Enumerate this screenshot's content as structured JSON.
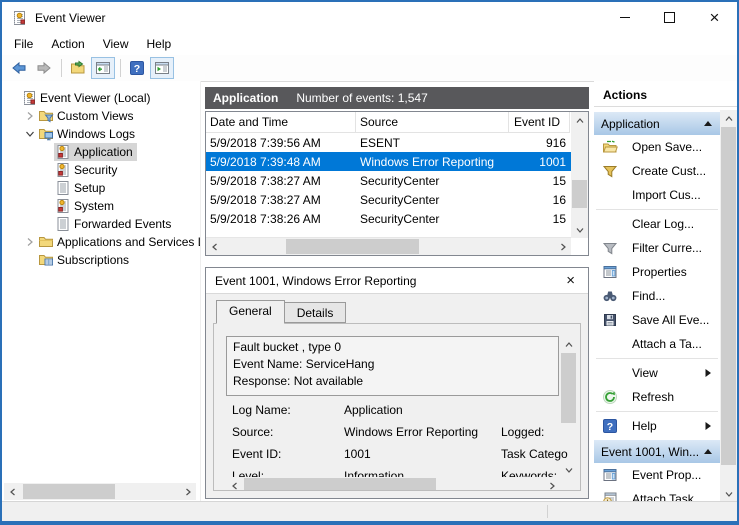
{
  "colors": {
    "window_border": "#2a70b8",
    "selection_blue": "#0078d7",
    "inactive_selection_gray": "#d6d6d6",
    "log_header_bg": "#58585b",
    "action_header_gradient_top": "#dce9f6",
    "action_header_gradient_bottom": "#a8c7e6"
  },
  "window": {
    "title": "Event Viewer",
    "app_icon": "event-viewer",
    "controls": [
      {
        "name": "minimize"
      },
      {
        "name": "maximize"
      },
      {
        "name": "close"
      }
    ]
  },
  "menu": {
    "items": [
      {
        "label": "File"
      },
      {
        "label": "Action"
      },
      {
        "label": "View"
      },
      {
        "label": "Help"
      }
    ]
  },
  "toolbar": {
    "buttons": [
      {
        "icon": "back",
        "toggled": false
      },
      {
        "icon": "forward",
        "toggled": false
      },
      {
        "sep": true
      },
      {
        "icon": "export",
        "toggled": false
      },
      {
        "icon": "console-tree",
        "toggled": true
      },
      {
        "sep": true
      },
      {
        "icon": "help",
        "toggled": false
      },
      {
        "icon": "action-pane",
        "toggled": true
      }
    ]
  },
  "tree": {
    "items": [
      {
        "label": "Event Viewer (Local)",
        "level": 0,
        "expander": "none",
        "icon": "event-viewer",
        "selected": false
      },
      {
        "label": "Custom Views",
        "level": 1,
        "expander": "collapsed",
        "icon": "folder-filter",
        "selected": false
      },
      {
        "label": "Windows Logs",
        "level": 1,
        "expander": "expanded",
        "icon": "folder-logs",
        "selected": false
      },
      {
        "label": "Application",
        "level": 2,
        "expander": "none",
        "icon": "log-err",
        "selected": true
      },
      {
        "label": "Security",
        "level": 2,
        "expander": "none",
        "icon": "log-err",
        "selected": false
      },
      {
        "label": "Setup",
        "level": 2,
        "expander": "none",
        "icon": "log-plain",
        "selected": false
      },
      {
        "label": "System",
        "level": 2,
        "expander": "none",
        "icon": "log-err",
        "selected": false
      },
      {
        "label": "Forwarded Events",
        "level": 2,
        "expander": "none",
        "icon": "log-plain",
        "selected": false
      },
      {
        "label": "Applications and Services Lo",
        "level": 1,
        "expander": "collapsed",
        "icon": "folder",
        "selected": false
      },
      {
        "label": "Subscriptions",
        "level": 1,
        "expander": "none",
        "icon": "folder-table",
        "selected": false
      }
    ]
  },
  "events": {
    "log_name": "Application",
    "count_label": "Number of events: 1,547",
    "columns": [
      "Date and Time",
      "Source",
      "Event ID"
    ],
    "rows": [
      {
        "datetime": "5/9/2018 7:39:56 AM",
        "source": "ESENT",
        "event_id": "916",
        "selected": false
      },
      {
        "datetime": "5/9/2018 7:39:48 AM",
        "source": "Windows Error Reporting",
        "event_id": "1001",
        "selected": true
      },
      {
        "datetime": "5/9/2018 7:38:27 AM",
        "source": "SecurityCenter",
        "event_id": "15",
        "selected": false
      },
      {
        "datetime": "5/9/2018 7:38:27 AM",
        "source": "SecurityCenter",
        "event_id": "16",
        "selected": false
      },
      {
        "datetime": "5/9/2018 7:38:26 AM",
        "source": "SecurityCenter",
        "event_id": "15",
        "selected": false
      }
    ]
  },
  "preview": {
    "title": "Event 1001, Windows Error Reporting",
    "close_icon": "close-x",
    "tabs": [
      {
        "label": "General",
        "active": true
      },
      {
        "label": "Details",
        "active": false
      }
    ],
    "description_lines": [
      "Fault bucket , type 0",
      "Event Name: ServiceHang",
      "Response: Not available"
    ],
    "fields": [
      {
        "label": "Log Name:",
        "value": "Application",
        "label2": ""
      },
      {
        "label": "Source:",
        "value": "Windows Error Reporting",
        "label2": "Logged:"
      },
      {
        "label": "Event ID:",
        "value": "1001",
        "label2": "Task Catego"
      },
      {
        "label": "Level:",
        "value": "Information",
        "label2": "Keywords:"
      }
    ]
  },
  "actions": {
    "title": "Actions",
    "sections": [
      {
        "header": "Application",
        "collapse_icon": "collapse-up",
        "items": [
          {
            "label": "Open Save...",
            "icon": "open-folder"
          },
          {
            "label": "Create Cust...",
            "icon": "filter-yellow"
          },
          {
            "label": "Import Cus...",
            "icon": ""
          },
          {
            "sep": true
          },
          {
            "label": "Clear Log...",
            "icon": ""
          },
          {
            "label": "Filter Curre...",
            "icon": "filter-gray"
          },
          {
            "label": "Properties",
            "icon": "properties"
          },
          {
            "label": "Find...",
            "icon": "binoculars"
          },
          {
            "label": "Save All Eve...",
            "icon": "save"
          },
          {
            "label": "Attach a Ta...",
            "icon": ""
          },
          {
            "sep": true
          },
          {
            "label": "View",
            "icon": "",
            "submenu": true
          },
          {
            "label": "Refresh",
            "icon": "refresh"
          },
          {
            "sep": true
          },
          {
            "label": "Help",
            "icon": "help",
            "submenu": true
          }
        ]
      },
      {
        "header": "Event 1001, Win...",
        "collapse_icon": "collapse-up",
        "items": [
          {
            "label": "Event Prop...",
            "icon": "properties"
          },
          {
            "label": "Attach Task...",
            "icon": "task"
          }
        ]
      }
    ]
  },
  "statusbar": {
    "text": ""
  }
}
